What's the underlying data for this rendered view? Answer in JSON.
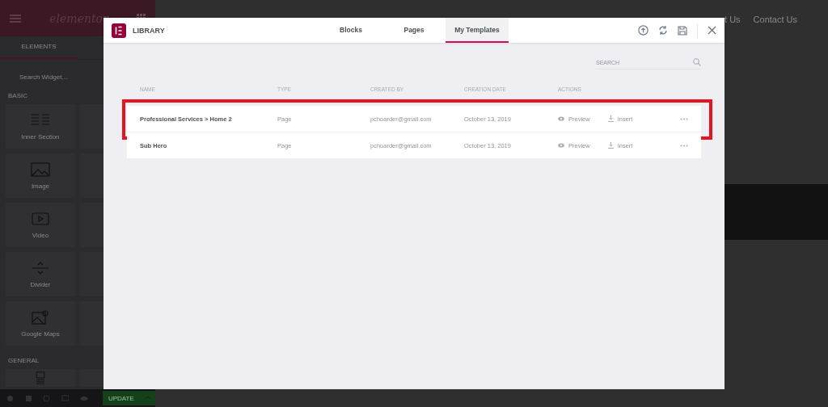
{
  "editor": {
    "sidebar": {
      "logo": "elementor",
      "tab": "ELEMENTS",
      "search": {
        "placeholder": "Search Widget..."
      },
      "sections": [
        {
          "title": "BASIC",
          "widgets": [
            {
              "label": "Inner Section",
              "kind": "columns"
            },
            {
              "label": "Image",
              "kind": "image"
            },
            {
              "label": "Video",
              "kind": "video"
            },
            {
              "label": "Divider",
              "kind": "divider"
            },
            {
              "label": "Google Maps",
              "kind": "map"
            }
          ]
        },
        {
          "title": "GENERAL",
          "widgets": [
            {
              "kind": "gallery"
            }
          ]
        }
      ],
      "update_button": "UPDATE"
    },
    "page": {
      "nav": [
        "t Us",
        "Contact Us"
      ]
    }
  },
  "library": {
    "title": "LIBRARY",
    "tabs": [
      {
        "label": "Blocks",
        "selected": false
      },
      {
        "label": "Pages",
        "selected": false
      },
      {
        "label": "My Templates",
        "selected": true
      }
    ],
    "search": {
      "placeholder": "SEARCH"
    },
    "columns": [
      "NAME",
      "TYPE",
      "CREATED BY",
      "CREATION DATE",
      "ACTIONS"
    ],
    "rows": [
      {
        "name": "Professional Services > Home 2",
        "type": "Page",
        "created_by": "pchoarder@gmail.com",
        "date": "October 13, 2019",
        "preview": "Preview",
        "insert": "Insert",
        "highlighted": true
      },
      {
        "name": "Sub Hero",
        "type": "Page",
        "created_by": "pchoarder@gmail.com",
        "date": "October 13, 2019",
        "preview": "Preview",
        "insert": "Insert",
        "highlighted": false
      }
    ]
  }
}
